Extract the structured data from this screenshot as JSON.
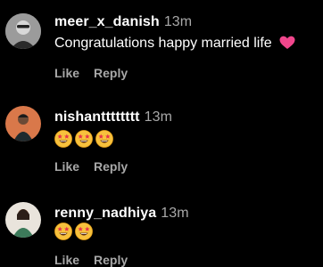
{
  "comments": [
    {
      "username": "meer_x_danish",
      "time": "13m",
      "text": "Congratulations happy married life",
      "like_label": "Like",
      "reply_label": "Reply",
      "avatar_icon": "avatar-man-sunglasses"
    },
    {
      "username": "nishantttttttt",
      "time": "13m",
      "emoji": [
        "star-struck-emoji",
        "star-struck-emoji",
        "star-struck-emoji"
      ],
      "like_label": "Like",
      "reply_label": "Reply",
      "avatar_icon": "avatar-man-orange-background"
    },
    {
      "username": "renny_nadhiya",
      "time": "13m",
      "emoji": [
        "star-struck-emoji",
        "star-struck-emoji"
      ],
      "like_label": "Like",
      "reply_label": "Reply",
      "avatar_icon": "avatar-woman-green-dress"
    }
  ],
  "colors": {
    "background": "#000000",
    "text": "#ffffff",
    "secondary": "#a8a8a8",
    "heart": "#f0468c"
  }
}
